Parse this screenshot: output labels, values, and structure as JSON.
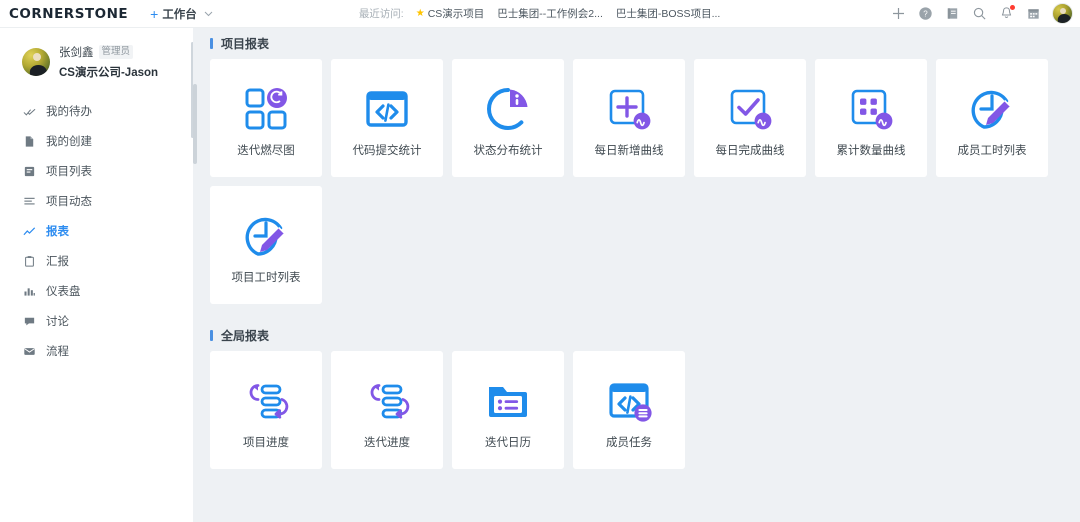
{
  "brand": "CORNERSTONE",
  "topbar": {
    "workspace_plus": "+",
    "workspace_label": "工作台",
    "workspace_chevron": "chevron-down-icon",
    "recent_label": "最近访问:",
    "recent_items": [
      {
        "label": "CS演示项目",
        "starred": true
      },
      {
        "label": "巴士集团--工作例会2...",
        "starred": false
      },
      {
        "label": "巴士集团-BOSS项目...",
        "starred": false
      }
    ],
    "icons": [
      {
        "name": "plus-icon",
        "glyph": "+"
      },
      {
        "name": "help-circle-icon",
        "glyph": "?"
      },
      {
        "name": "notebook-icon",
        "glyph": "book"
      },
      {
        "name": "search-icon",
        "glyph": "search"
      },
      {
        "name": "bell-icon",
        "glyph": "bell",
        "badge": true
      },
      {
        "name": "calendar-icon",
        "glyph": "calendar"
      }
    ],
    "avatar": "user-avatar"
  },
  "sidebar": {
    "user": {
      "name": "张剑鑫",
      "tag": "管理员",
      "company": "CS演示公司-Jason"
    },
    "items": [
      {
        "label": "我的待办",
        "icon": "double-check-icon",
        "active": false
      },
      {
        "label": "我的创建",
        "icon": "file-icon",
        "active": false
      },
      {
        "label": "项目列表",
        "icon": "project-list-icon",
        "active": false
      },
      {
        "label": "项目动态",
        "icon": "activity-lines-icon",
        "active": false
      },
      {
        "label": "报表",
        "icon": "chart-line-icon",
        "active": true
      },
      {
        "label": "汇报",
        "icon": "clipboard-icon",
        "active": false
      },
      {
        "label": "仪表盘",
        "icon": "bar-chart-icon",
        "active": false
      },
      {
        "label": "讨论",
        "icon": "comment-icon",
        "active": false
      },
      {
        "label": "流程",
        "icon": "envelope-icon",
        "active": false
      }
    ]
  },
  "colors": {
    "accent_blue": "#2d8cf0",
    "icon_blue": "#1f8ceb",
    "icon_purple": "#8257e6",
    "page_bg": "#eef1f4",
    "card_bg": "#ffffff",
    "star_yellow": "#ffc400",
    "badge_red": "#ff3b30"
  },
  "main": {
    "sections": [
      {
        "title": "项目报表",
        "cards": [
          {
            "label": "迭代燃尽图",
            "icon": "iteration-burndown-icon"
          },
          {
            "label": "代码提交统计",
            "icon": "code-commit-icon"
          },
          {
            "label": "状态分布统计",
            "icon": "status-pie-icon"
          },
          {
            "label": "每日新增曲线",
            "icon": "daily-new-curve-icon"
          },
          {
            "label": "每日完成曲线",
            "icon": "daily-done-curve-icon"
          },
          {
            "label": "累计数量曲线",
            "icon": "cumulative-count-curve-icon"
          },
          {
            "label": "成员工时列表",
            "icon": "member-timesheet-icon"
          },
          {
            "label": "项目工时列表",
            "icon": "project-timesheet-icon"
          }
        ]
      },
      {
        "title": "全局报表",
        "cards": [
          {
            "label": "项目进度",
            "icon": "project-progress-icon"
          },
          {
            "label": "迭代进度",
            "icon": "iteration-progress-icon"
          },
          {
            "label": "迭代日历",
            "icon": "iteration-calendar-icon"
          },
          {
            "label": "成员任务",
            "icon": "member-task-icon"
          }
        ]
      }
    ]
  }
}
